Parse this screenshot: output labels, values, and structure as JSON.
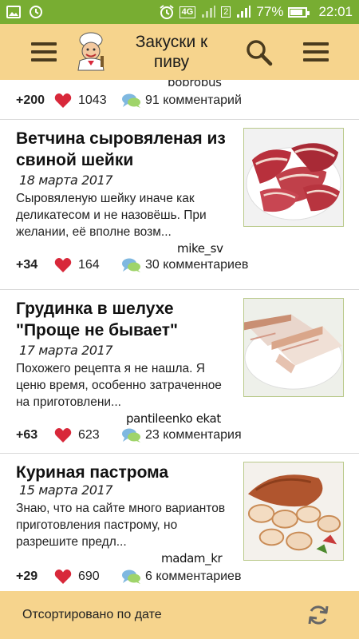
{
  "status_bar": {
    "battery": "77%",
    "time": "22:01",
    "network": "4G",
    "sim_badge": "2"
  },
  "header": {
    "title": "Закуски к пиву",
    "menu_icon": "hamburger-icon",
    "search_icon": "search-icon",
    "logo_icon": "chef-logo-icon"
  },
  "feed": {
    "prev_item": {
      "author": "bobrobus",
      "score": "+200",
      "likes": "1043",
      "comments": "91 комментарий"
    },
    "items": [
      {
        "title": "Ветчина сыровяленая из свиной шейки",
        "date": "18 марта 2017",
        "description": "Сыровяленую шейку иначе как деликатесом и не назовёшь. При желании, её вполне возм...",
        "author": "mike_sv",
        "score": "+34",
        "likes": "164",
        "comments": "30 комментариев"
      },
      {
        "title": "Грудинка в шелухе \"Проще не бывает\"",
        "date": "17 марта 2017",
        "description": "Похожего рецепта я не нашла. Я ценю время, особенно затраченное на приготовлени...",
        "author": "pantileenko ekat",
        "score": "+63",
        "likes": "623",
        "comments": "23 комментария"
      },
      {
        "title": "Куриная пастрома",
        "date": "15 марта 2017",
        "description": "Знаю, что на сайте много вариантов приготовления пастрому, но разрешите предл...",
        "author": "madam_kr",
        "score": "+29",
        "likes": "690",
        "comments": "6 комментариев"
      }
    ]
  },
  "bottom_bar": {
    "sort_label": "Отсортировано по дате",
    "refresh_icon": "refresh-icon"
  },
  "colors": {
    "status_bar": "#78ad32",
    "header_bg": "#f6d48d",
    "heart": "#d8283a",
    "bubble": "#7fb8e0"
  }
}
